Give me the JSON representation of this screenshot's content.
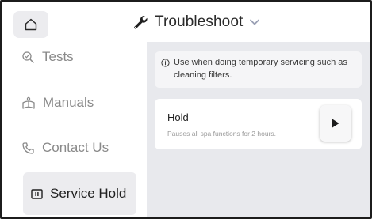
{
  "header": {
    "title": "Troubleshoot",
    "home_icon": "home-icon",
    "title_icon": "wrench-icon",
    "dropdown_icon": "chevron-down-icon"
  },
  "sidebar": {
    "items": [
      {
        "label": "Tests",
        "icon": "tests-icon",
        "active": false
      },
      {
        "label": "Manuals",
        "icon": "manuals-icon",
        "active": false
      },
      {
        "label": "Contact Us",
        "icon": "phone-icon",
        "active": false
      },
      {
        "label": "Service Hold",
        "icon": "pause-icon",
        "active": true
      }
    ]
  },
  "main": {
    "info": {
      "icon": "info-icon",
      "text": "Use when doing temporary servicing such as cleaning filters."
    },
    "hold": {
      "title": "Hold",
      "description": "Pauses all spa functions for 2 hours.",
      "action_icon": "play-icon"
    }
  },
  "colors": {
    "content_bg": "#e8e9ed",
    "active_bg": "#ececef",
    "text_primary": "#202020",
    "text_muted": "#8a8a8a"
  }
}
